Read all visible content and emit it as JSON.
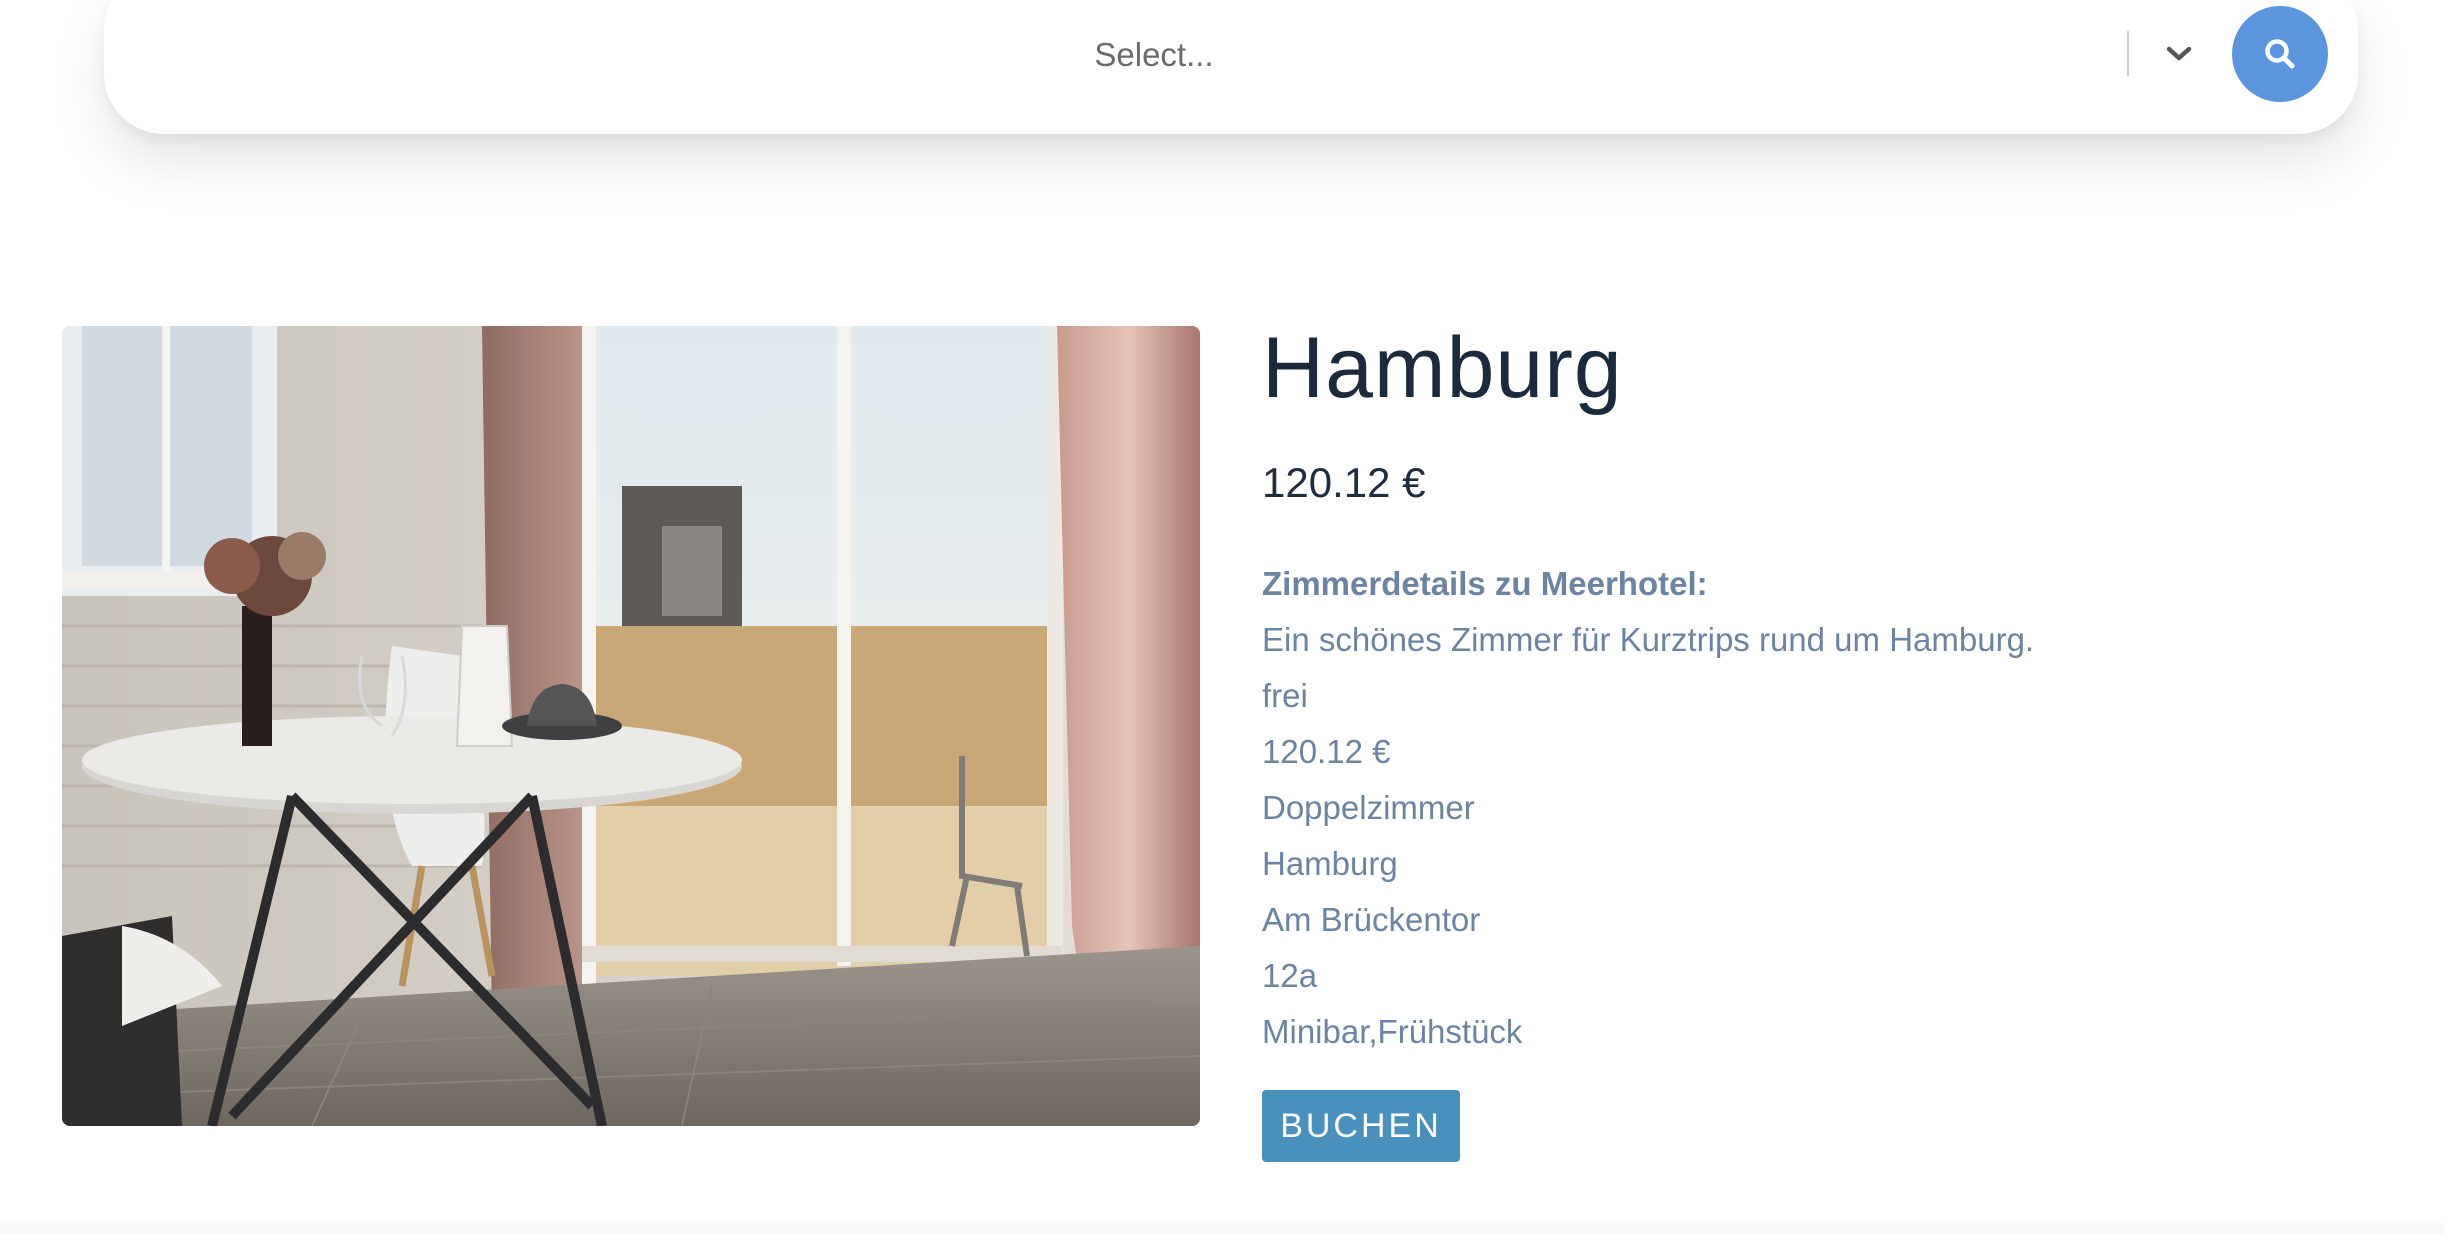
{
  "search": {
    "placeholder": "Select..."
  },
  "room": {
    "city": "Hamburg",
    "price": "120.12 €",
    "details_heading": "Zimmerdetails zu Meerhotel:",
    "description": "Ein schönes Zimmer für Kurztrips rund um Hamburg.",
    "availability": "frei",
    "price_detail": "120.12 €",
    "room_type": "Doppelzimmer",
    "city_detail": "Hamburg",
    "street": "Am Brückentor",
    "house_number": "12a",
    "amenities": "Minibar,Frühstück",
    "book_label": "BUCHEN"
  },
  "colors": {
    "accent_blue": "#5b95de",
    "button_blue": "#4a90bd",
    "title_text": "#1b2a3d",
    "detail_text": "#6c84a1"
  },
  "icons": {
    "select_arrow": "chevron-down-icon",
    "search": "search-icon"
  }
}
